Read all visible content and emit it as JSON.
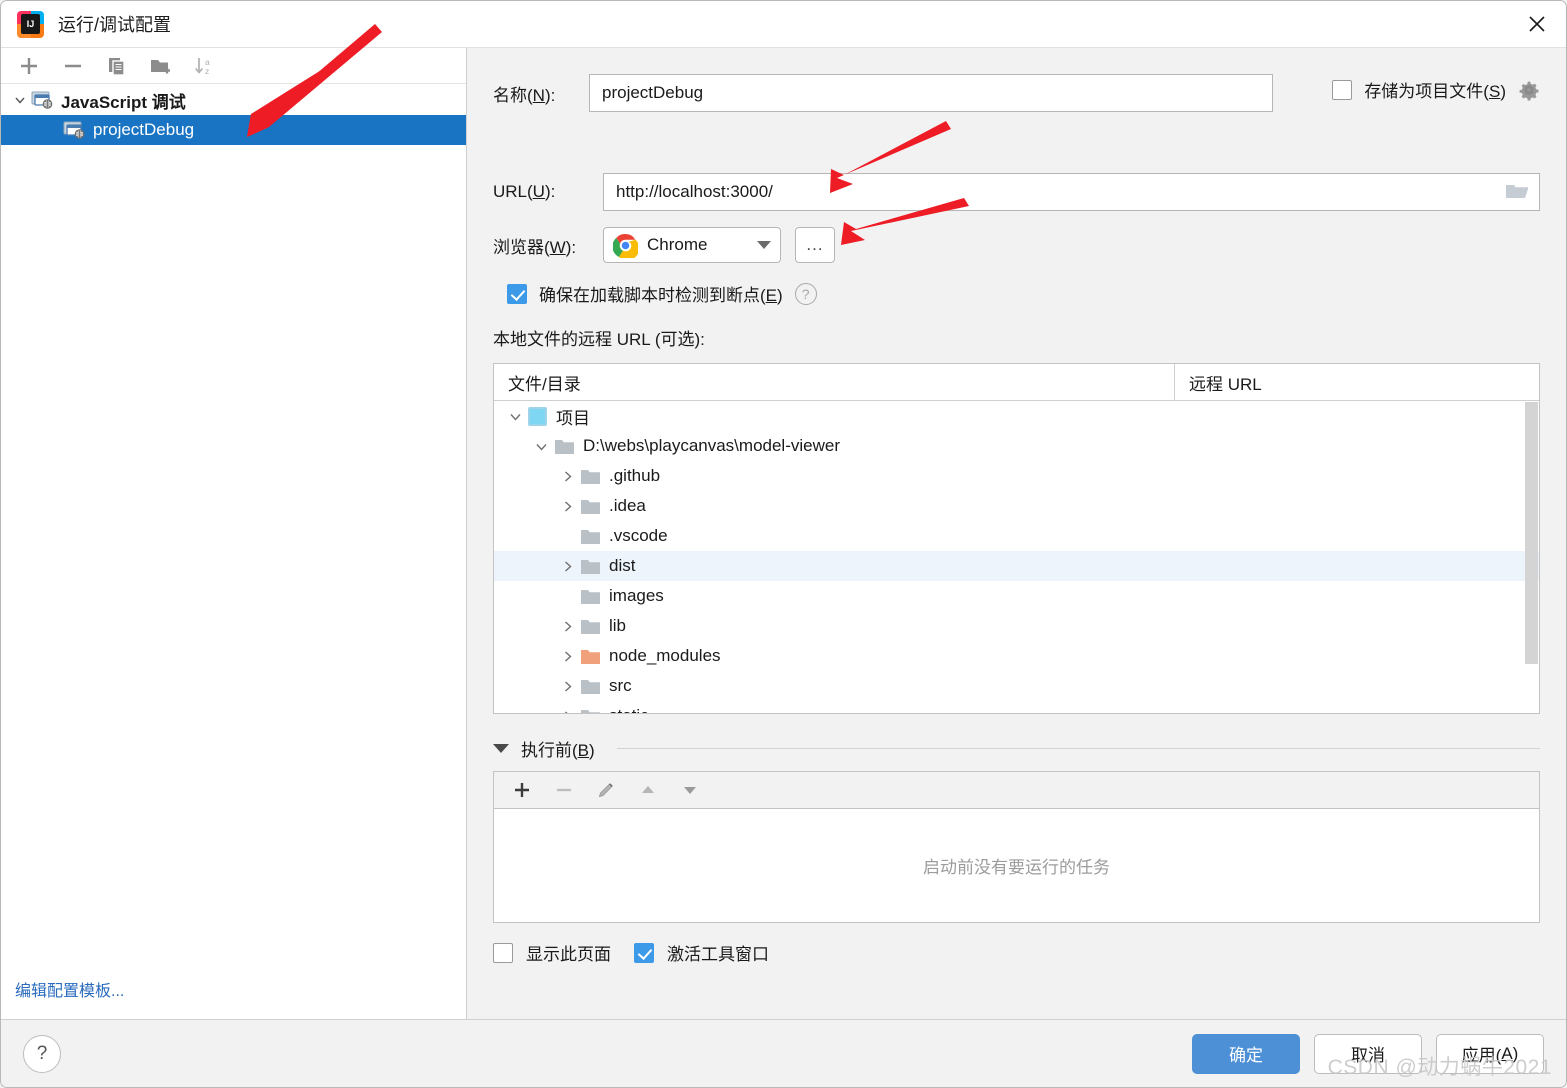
{
  "window": {
    "title": "运行/调试配置",
    "logo_text": "IJ",
    "close_icon": "close-icon"
  },
  "left_pane": {
    "toolbar": [
      {
        "name": "add-configuration-button",
        "icon": "plus-icon"
      },
      {
        "name": "remove-configuration-button",
        "icon": "minus-icon"
      },
      {
        "name": "copy-configuration-button",
        "icon": "copy-icon"
      },
      {
        "name": "new-folder-button",
        "icon": "folder-add-icon"
      },
      {
        "name": "sort-configurations-button",
        "icon": "sort-alpha-icon"
      }
    ],
    "tree": [
      {
        "label": "JavaScript 调试",
        "level": 0,
        "expanded": true,
        "selected": false,
        "icon": "javascript-debug-icon"
      },
      {
        "label": "projectDebug",
        "level": 1,
        "expanded": false,
        "selected": true,
        "icon": "javascript-debug-icon"
      }
    ],
    "edit_templates_link": "编辑配置模板..."
  },
  "form": {
    "name_label": "名称(N):",
    "name_label_plain": "名称",
    "name_mnemonic": "N",
    "name_value": "projectDebug",
    "store_as_project_file_label_prefix": "存储为项目文件(",
    "store_as_project_file_mnemonic": "S",
    "store_as_project_file_checked": false,
    "gear_icon": "gear-icon",
    "url_label_prefix": "URL(",
    "url_mnemonic": "U",
    "url_value": "http://localhost:3000/",
    "browse_icon": "folder-open-icon",
    "browser_label_prefix": "浏览器(",
    "browser_mnemonic": "W",
    "browser_value": "Chrome",
    "browser_icon": "chrome-icon",
    "browser_more_button": "...",
    "breakpoint_label_prefix": "确保在加载脚本时检测到断点(",
    "breakpoint_mnemonic": "E",
    "breakpoint_checked": true,
    "help_icon": "question-mark-icon",
    "remote_url_section_label": "本地文件的远程 URL (可选):"
  },
  "file_table": {
    "columns": [
      "文件/目录",
      "远程 URL"
    ],
    "rows": [
      {
        "label": "项目",
        "indent": 0,
        "icon": "project-icon",
        "expander": "expanded",
        "selected": false
      },
      {
        "label": "D:\\webs\\playcanvas\\model-viewer",
        "indent": 1,
        "icon": "folder-icon",
        "expander": "expanded",
        "selected": false
      },
      {
        "label": ".github",
        "indent": 2,
        "icon": "folder-icon",
        "expander": "collapsed",
        "selected": false
      },
      {
        "label": ".idea",
        "indent": 2,
        "icon": "folder-icon",
        "expander": "collapsed",
        "selected": false
      },
      {
        "label": ".vscode",
        "indent": 2,
        "icon": "folder-icon",
        "expander": "none",
        "selected": false
      },
      {
        "label": "dist",
        "indent": 2,
        "icon": "folder-icon",
        "expander": "collapsed",
        "selected": true
      },
      {
        "label": "images",
        "indent": 2,
        "icon": "folder-icon",
        "expander": "none",
        "selected": false
      },
      {
        "label": "lib",
        "indent": 2,
        "icon": "folder-icon",
        "expander": "collapsed",
        "selected": false
      },
      {
        "label": "node_modules",
        "indent": 2,
        "icon": "folder-orange-icon",
        "expander": "collapsed",
        "selected": false
      },
      {
        "label": "src",
        "indent": 2,
        "icon": "folder-icon",
        "expander": "collapsed",
        "selected": false
      },
      {
        "label": "static",
        "indent": 2,
        "icon": "folder-icon",
        "expander": "collapsed",
        "selected": false
      }
    ]
  },
  "before_launch": {
    "label_prefix": "执行前(",
    "mnemonic": "B",
    "toolbar": [
      {
        "name": "add-task-button",
        "icon": "plus-icon",
        "enabled": true
      },
      {
        "name": "remove-task-button",
        "icon": "minus-icon",
        "enabled": false
      },
      {
        "name": "edit-task-button",
        "icon": "pencil-icon",
        "enabled": false
      },
      {
        "name": "move-task-up-button",
        "icon": "arrow-up-icon",
        "enabled": false
      },
      {
        "name": "move-task-down-button",
        "icon": "arrow-down-icon",
        "enabled": false
      }
    ],
    "empty_text": "启动前没有要运行的任务",
    "show_page_label": "显示此页面",
    "show_page_checked": false,
    "activate_tool_window_label": "激活工具窗口",
    "activate_tool_window_checked": true
  },
  "footer": {
    "help_icon": "question-mark-icon",
    "ok_label": "确定",
    "cancel_label": "取消",
    "apply_label_prefix": "应用(",
    "apply_mnemonic": "A"
  },
  "watermark": "CSDN @动力蜗牛2021",
  "colors": {
    "selection_blue": "#1a74c4",
    "primary_button": "#4d90d6",
    "checkbox_accent": "#3d9ae8",
    "link_blue": "#2a6bbd",
    "annotation_red": "#ee1c25",
    "row_highlight": "#eef4fb"
  }
}
